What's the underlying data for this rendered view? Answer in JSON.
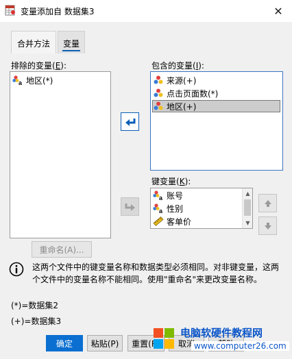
{
  "window": {
    "title": "变量添加自 数据集3",
    "close_glyph": "✕"
  },
  "tabs": [
    {
      "label": "合并方法",
      "active": false
    },
    {
      "label": "变量",
      "active": true
    }
  ],
  "excluded": {
    "label_prefix": "排除的变量(",
    "label_key": "E",
    "label_suffix": "):",
    "items": [
      {
        "name": "地区(*)",
        "icon": "nominal-string-icon"
      }
    ]
  },
  "included": {
    "label_prefix": "包含的变量(",
    "label_key": "I",
    "label_suffix": "):",
    "items": [
      {
        "name": "来源(+)",
        "icon": "nominal-icon"
      },
      {
        "name": "点击页面数(*)",
        "icon": "nominal-icon"
      },
      {
        "name": "地区(+)",
        "icon": "nominal-icon",
        "selected": true
      }
    ]
  },
  "keys": {
    "label_prefix": "键变量(",
    "label_key": "K",
    "label_suffix": "):",
    "items": [
      {
        "name": "账号",
        "icon": "nominal-string-icon"
      },
      {
        "name": "性别",
        "icon": "nominal-string-icon"
      },
      {
        "name": "客单价",
        "icon": "scale-icon"
      }
    ]
  },
  "rename_button": "重命名(A)...",
  "info": {
    "text": "这两个文件中的键变量名称和数据类型必须相同。对非键变量，这两个文件中的变量名称不能相同。使用\"重命名\"来更改变量名称。"
  },
  "legend": {
    "star": "(*)=数据集2",
    "plus": "(+)=数据集3"
  },
  "buttons": {
    "ok": "确定",
    "paste": "粘贴(P)",
    "reset": "重置(R)",
    "cancel": "取消",
    "help": "帮助"
  },
  "watermark": {
    "title": "电脑软硬件教程网",
    "url": "www.computer26.com"
  },
  "colors": {
    "accent": "#0b6fd1",
    "selection": "#cdcdcd",
    "watermark": "#0a55c8"
  }
}
